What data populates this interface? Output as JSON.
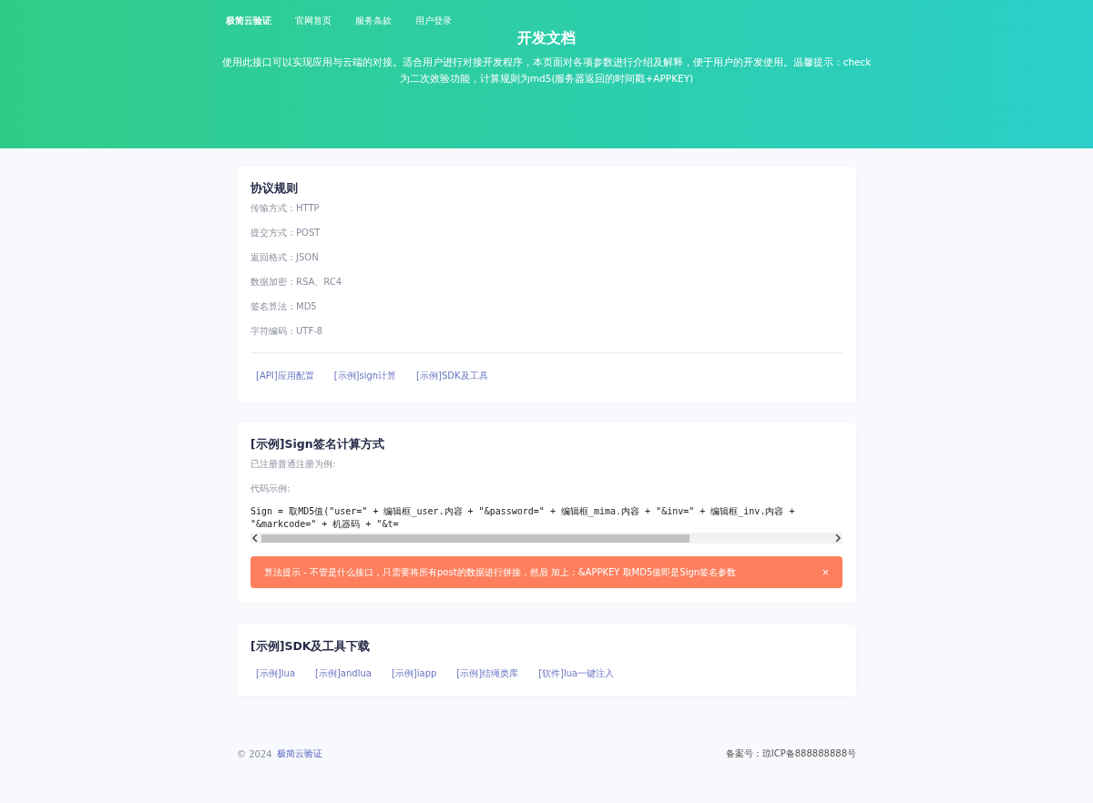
{
  "nav": {
    "brand": "极简云验证",
    "links": [
      "官网首页",
      "服务条款",
      "用户登录"
    ]
  },
  "hero": {
    "title": "开发文档",
    "description": "使用此接口可以实现应用与云端的对接。适合用户进行对接开发程序，本页面对各项参数进行介绍及解释，便于用户的开发使用。温馨提示：check为二次效验功能，计算规则为md5(服务器返回的时间戳+APPKEY)"
  },
  "protocol": {
    "title": "协议规则",
    "rules": [
      {
        "label": "传输方式：",
        "value": "HTTP"
      },
      {
        "label": "提交方式：",
        "value": "POST"
      },
      {
        "label": "返回格式：",
        "value": "JSON"
      },
      {
        "label": "数据加密：",
        "value": "RSA、RC4"
      },
      {
        "label": "签名算法：",
        "value": "MD5"
      },
      {
        "label": "字符编码：",
        "value": "UTF-8"
      }
    ],
    "links": [
      "[API]应用配置",
      "[示例]sign计算",
      "[示例]SDK及工具"
    ]
  },
  "sign": {
    "title": "[示例]Sign签名计算方式",
    "intro": "已注册普通注册为例:",
    "code_label": "代码示例:",
    "code": "Sign = 取MD5值(\"user=\" + 编辑框_user.内容 + \"&password=\" + 编辑框_mima.内容 + \"&inv=\" + 编辑框_inv.内容 + \"&markcode=\" + 机器码 + \"&t=",
    "alert": {
      "text": "算法提示 - 不管是什么接口，只需要将所有post的数据进行拼接，然后 加上：&APPKEY 取MD5值即是Sign签名参数",
      "close": "×"
    }
  },
  "sdk": {
    "title": "[示例]SDK及工具下载",
    "links": [
      "[示例]lua",
      "[示例]andlua",
      "[示例]iapp",
      "[示例]结绳类库",
      "[软件]lua一键注入"
    ]
  },
  "footer": {
    "copyright": "© 2024",
    "brand": "极简云验证",
    "icp": "备案号：琼ICP备888888888号"
  }
}
